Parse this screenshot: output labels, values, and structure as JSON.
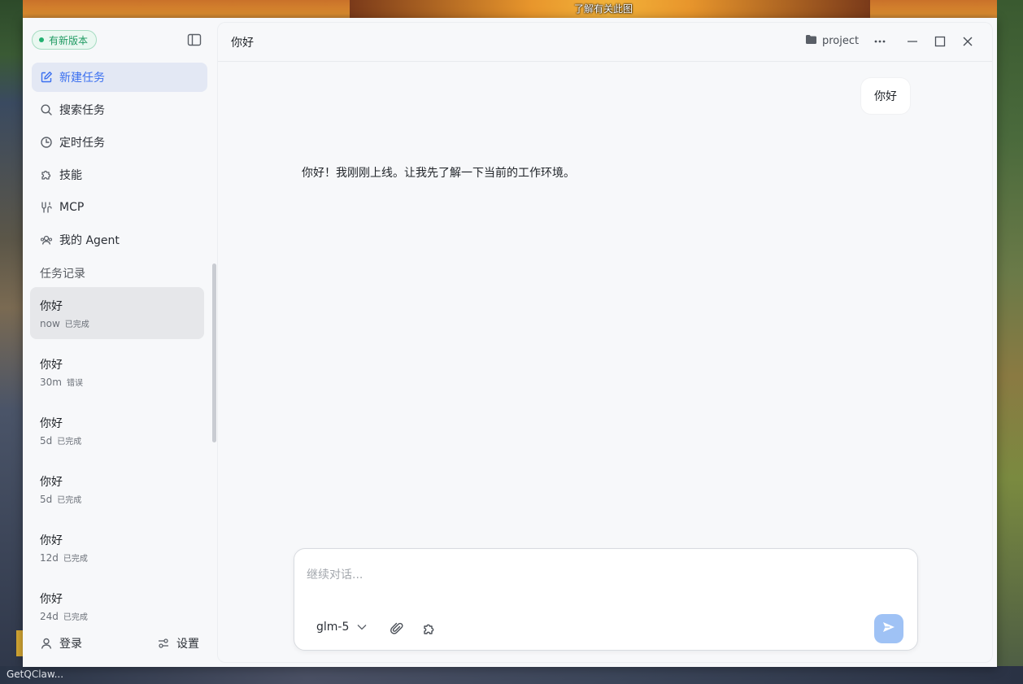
{
  "desktop": {
    "top_caption": "了解有关此图",
    "taskbar_label": "GetQClaw..."
  },
  "sidebar": {
    "update_badge": "有新版本",
    "nav": [
      {
        "label": "新建任务",
        "icon": "edit-icon",
        "active": true
      },
      {
        "label": "搜索任务",
        "icon": "search-icon"
      },
      {
        "label": "定时任务",
        "icon": "clock-icon"
      },
      {
        "label": "技能",
        "icon": "puzzle-icon"
      },
      {
        "label": "MCP",
        "icon": "plug-icon"
      },
      {
        "label": "我的 Agent",
        "icon": "agent-icon"
      }
    ],
    "history_label": "任务记录",
    "history": [
      {
        "title": "你好",
        "time": "now",
        "status": "已完成",
        "selected": true
      },
      {
        "title": "你好",
        "time": "30m",
        "status": "错误"
      },
      {
        "title": "你好",
        "time": "5d",
        "status": "已完成"
      },
      {
        "title": "你好",
        "time": "5d",
        "status": "已完成"
      },
      {
        "title": "你好",
        "time": "12d",
        "status": "已完成"
      },
      {
        "title": "你好",
        "time": "24d",
        "status": "已完成"
      }
    ],
    "footer": {
      "login": "登录",
      "settings": "设置"
    }
  },
  "header": {
    "title": "你好",
    "project": "project"
  },
  "conversation": {
    "user_message": "你好",
    "assistant_message": "你好！我刚刚上线。让我先了解一下当前的工作环境。"
  },
  "composer": {
    "placeholder": "继续对话...",
    "value": "",
    "model": "glm-5"
  },
  "colors": {
    "accent": "#3a6ff0",
    "badge_green": "#1f9a62",
    "send_button": "#9fc2f5"
  }
}
